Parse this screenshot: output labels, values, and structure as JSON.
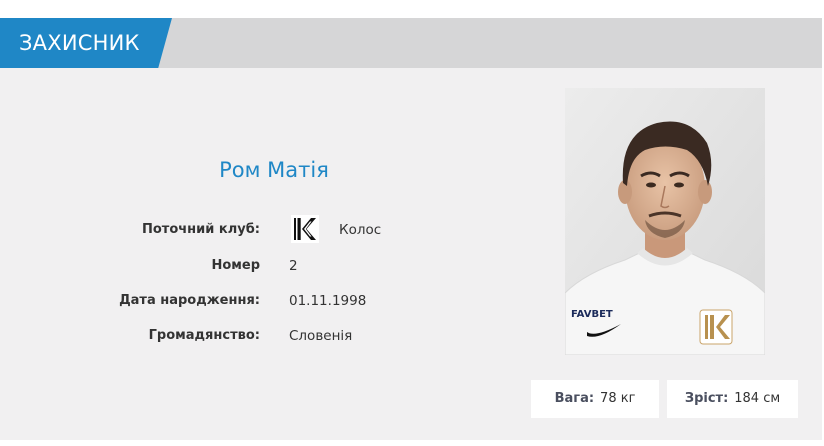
{
  "position": "ЗАХИСНИК",
  "player": {
    "name": "Ром Матія"
  },
  "info": {
    "club_label": "Поточний клуб:",
    "club_name": "Колос",
    "club_logo_icon": "kolos-club-logo",
    "number_label": "Номер",
    "number_value": "2",
    "birth_label": "Дата народження:",
    "birth_value": "01.11.1998",
    "citizenship_label": "Громадянство:",
    "citizenship_value": "Словенія"
  },
  "stats": {
    "weight_label": "Вага:",
    "weight_value": "78 кг",
    "height_label": "Зріст:",
    "height_value": "184 см"
  },
  "photo": {
    "sponsor": "FAVBET"
  },
  "colors": {
    "accent": "#1f87c6",
    "header_bar": "#d6d6d7",
    "card_bg": "#f1f0f1"
  }
}
